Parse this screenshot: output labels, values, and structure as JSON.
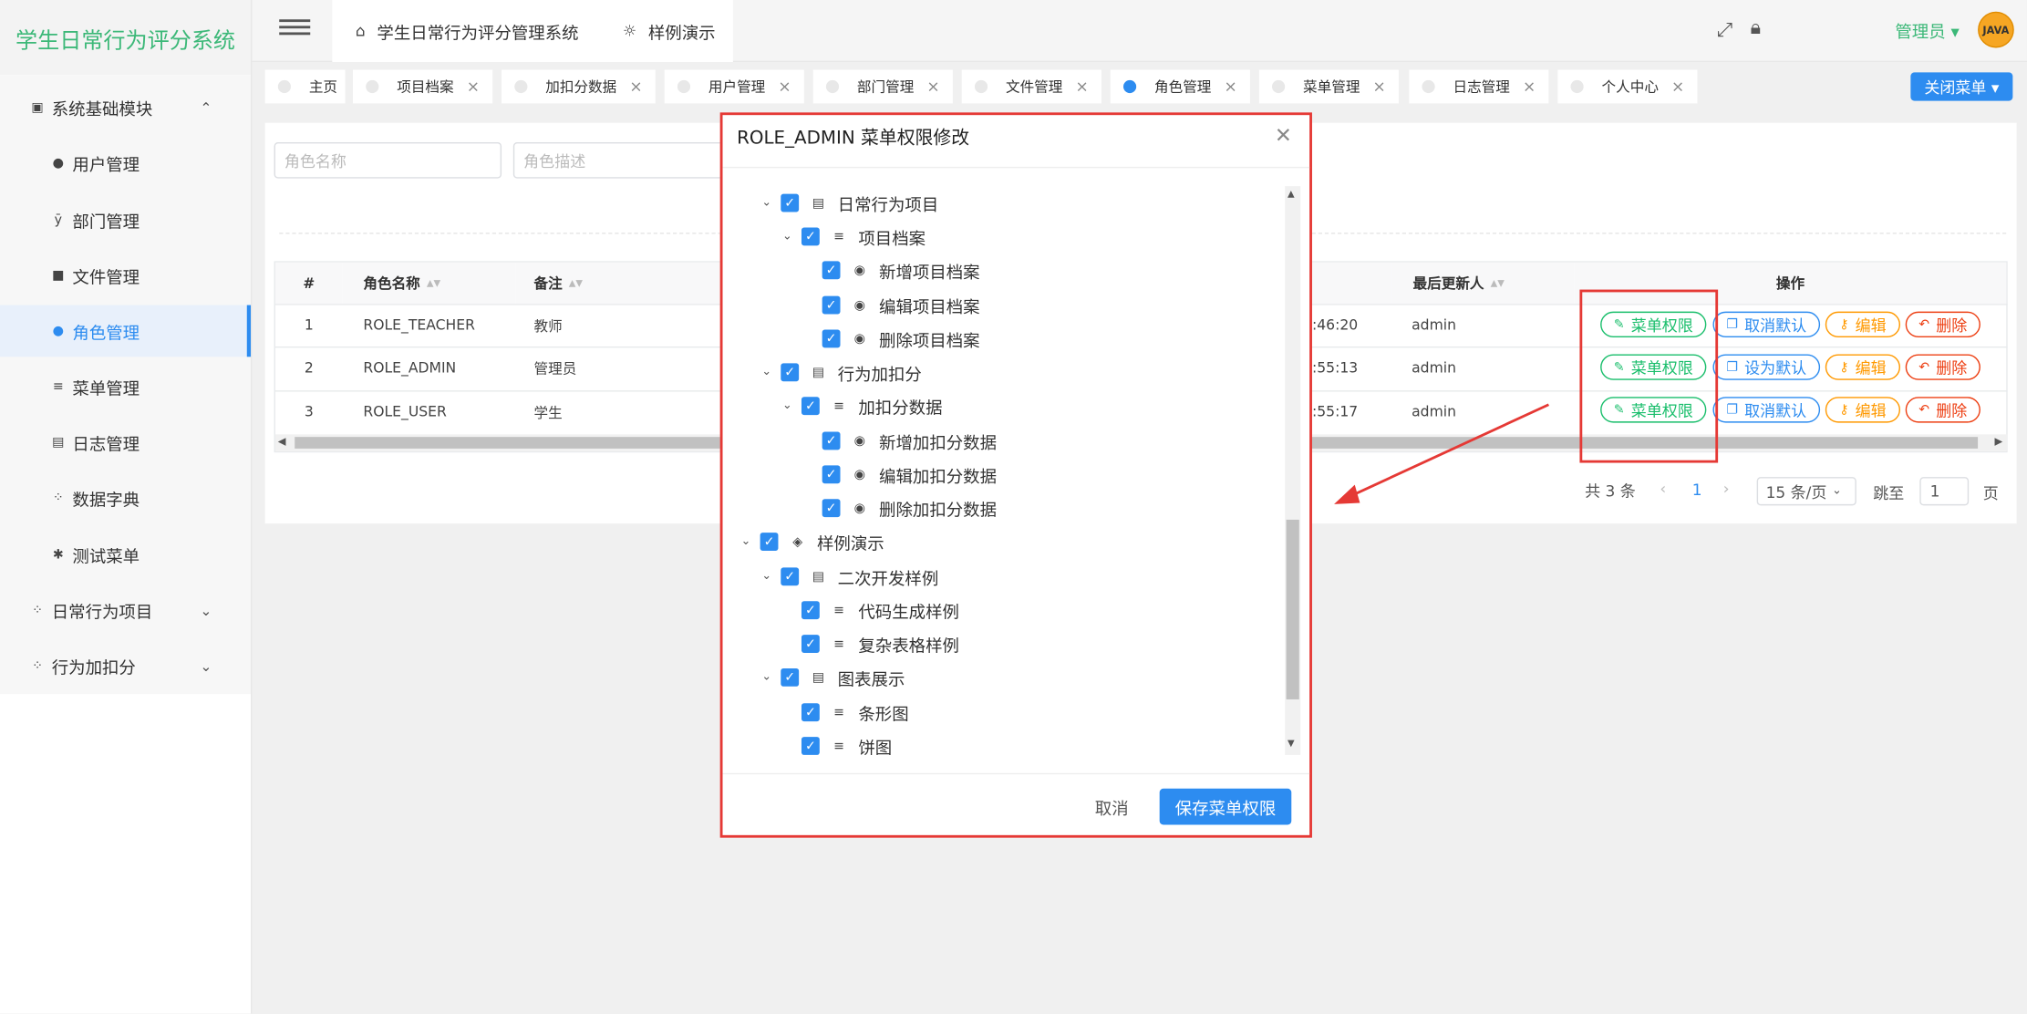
{
  "app": {
    "title": "学生日常行为评分系统"
  },
  "header": {
    "system_link": "学生日常行为评分管理系统",
    "demo_link": "样例演示",
    "user_label": "管理员 ▾",
    "avatar_text": "JAVA"
  },
  "sidebar": {
    "items": [
      {
        "label": "系统基础模块",
        "icon": "chart-icon",
        "expanded": true
      },
      {
        "label": "用户管理",
        "icon": "user-icon"
      },
      {
        "label": "部门管理",
        "icon": "branch-icon"
      },
      {
        "label": "文件管理",
        "icon": "folder-icon"
      },
      {
        "label": "角色管理",
        "icon": "people-icon",
        "active": true
      },
      {
        "label": "菜单管理",
        "icon": "menu-icon"
      },
      {
        "label": "日志管理",
        "icon": "log-icon"
      },
      {
        "label": "数据字典",
        "icon": "grid-icon"
      },
      {
        "label": "测试菜单",
        "icon": "bug-icon"
      },
      {
        "label": "日常行为项目",
        "icon": "grid-icon",
        "expanded": false
      },
      {
        "label": "行为加扣分",
        "icon": "grid-icon",
        "expanded": false
      }
    ]
  },
  "tabs": [
    {
      "label": "主页",
      "closable": false
    },
    {
      "label": "项目档案",
      "closable": true
    },
    {
      "label": "加扣分数据",
      "closable": true
    },
    {
      "label": "用户管理",
      "closable": true
    },
    {
      "label": "部门管理",
      "closable": true
    },
    {
      "label": "文件管理",
      "closable": true
    },
    {
      "label": "角色管理",
      "closable": true,
      "active": true
    },
    {
      "label": "菜单管理",
      "closable": true
    },
    {
      "label": "日志管理",
      "closable": true
    },
    {
      "label": "个人中心",
      "closable": true
    }
  ],
  "close_menu_label": "关闭菜单 ▾",
  "search": {
    "role_name_placeholder": "角色名称",
    "role_desc_placeholder": "角色描述"
  },
  "table": {
    "columns": [
      "#",
      "角色名称",
      "备注",
      "最后更新人",
      "操作"
    ],
    "rows": [
      {
        "index": "1",
        "role_name": "ROLE_TEACHER",
        "remark": "教师",
        "updated_time": ":46:20",
        "updated_by": "admin",
        "default_action": "取消默认"
      },
      {
        "index": "2",
        "role_name": "ROLE_ADMIN",
        "remark": "管理员",
        "updated_time": ":55:13",
        "updated_by": "admin",
        "default_action": "设为默认"
      },
      {
        "index": "3",
        "role_name": "ROLE_USER",
        "remark": "学生",
        "updated_time": ":55:17",
        "updated_by": "admin",
        "default_action": "取消默认"
      }
    ],
    "actions": {
      "menu_permission": "菜单权限",
      "edit": "编辑",
      "delete": "删除"
    }
  },
  "pagination": {
    "total": "共 3 条",
    "current_page": "1",
    "page_size": "15 条/页",
    "jump_label": "跳至",
    "jump_value": "1",
    "page_suffix": "页"
  },
  "modal": {
    "title": "ROLE_ADMIN 菜单权限修改",
    "tree": [
      {
        "label": "日常行为项目",
        "level": 1,
        "expanded": true,
        "checked": true,
        "icon": "doc-icon"
      },
      {
        "label": "项目档案",
        "level": 2,
        "expanded": true,
        "checked": true,
        "icon": "lines-icon"
      },
      {
        "label": "新增项目档案",
        "level": 3,
        "checked": true,
        "icon": "radio-icon"
      },
      {
        "label": "编辑项目档案",
        "level": 3,
        "checked": true,
        "icon": "radio-icon"
      },
      {
        "label": "删除项目档案",
        "level": 3,
        "checked": true,
        "icon": "radio-icon"
      },
      {
        "label": "行为加扣分",
        "level": 1,
        "expanded": true,
        "checked": true,
        "icon": "doc-icon"
      },
      {
        "label": "加扣分数据",
        "level": 2,
        "expanded": true,
        "checked": true,
        "icon": "lines-icon"
      },
      {
        "label": "新增加扣分数据",
        "level": 3,
        "checked": true,
        "icon": "radio-icon"
      },
      {
        "label": "编辑加扣分数据",
        "level": 3,
        "checked": true,
        "icon": "radio-icon"
      },
      {
        "label": "删除加扣分数据",
        "level": 3,
        "checked": true,
        "icon": "radio-icon"
      },
      {
        "label": "样例演示",
        "level": 0,
        "expanded": true,
        "checked": true,
        "icon": "compass-icon"
      },
      {
        "label": "二次开发样例",
        "level": 1,
        "expanded": true,
        "checked": true,
        "icon": "doc-icon"
      },
      {
        "label": "代码生成样例",
        "level": 2,
        "checked": true,
        "icon": "lines-icon"
      },
      {
        "label": "复杂表格样例",
        "level": 2,
        "checked": true,
        "icon": "lines-icon"
      },
      {
        "label": "图表展示",
        "level": 1,
        "expanded": true,
        "checked": true,
        "icon": "doc-icon"
      },
      {
        "label": "条形图",
        "level": 2,
        "checked": true,
        "icon": "lines-icon"
      },
      {
        "label": "饼图",
        "level": 2,
        "checked": true,
        "icon": "lines-icon"
      }
    ],
    "cancel_label": "取消",
    "save_label": "保存菜单权限"
  },
  "colors": {
    "accent": "#2d8cf0",
    "brand_green": "#3cb878",
    "success": "#19be6b",
    "warning": "#ff9900",
    "danger": "#ed4014",
    "annotation_red": "#e53935"
  }
}
